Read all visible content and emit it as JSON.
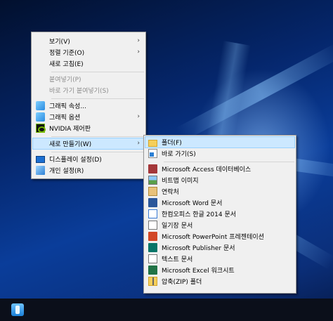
{
  "context_menu": {
    "items": [
      {
        "label": "보기(V)",
        "submenu": true,
        "disabled": false,
        "icon": ""
      },
      {
        "label": "정렬 기준(O)",
        "submenu": true,
        "disabled": false,
        "icon": ""
      },
      {
        "label": "새로 고침(E)",
        "submenu": false,
        "disabled": false,
        "icon": ""
      },
      {
        "label": "붙여넣기(P)",
        "submenu": false,
        "disabled": true,
        "icon": ""
      },
      {
        "label": "바로 가기 붙여넣기(S)",
        "submenu": false,
        "disabled": true,
        "icon": ""
      },
      {
        "label": "그래픽 속성...",
        "submenu": false,
        "disabled": false,
        "icon": "intel-graphics-icon"
      },
      {
        "label": "그래픽 옵션",
        "submenu": true,
        "disabled": false,
        "icon": "intel-graphics-icon"
      },
      {
        "label": "NVIDIA 제어판",
        "submenu": false,
        "disabled": false,
        "icon": "nvidia-icon"
      },
      {
        "label": "새로 만들기(W)",
        "submenu": true,
        "disabled": false,
        "icon": "",
        "highlighted": true
      },
      {
        "label": "디스플레이 설정(D)",
        "submenu": false,
        "disabled": false,
        "icon": "display-icon"
      },
      {
        "label": "개인 설정(R)",
        "submenu": false,
        "disabled": false,
        "icon": "personalize-icon"
      }
    ],
    "submenu_arrow": "›"
  },
  "new_submenu": {
    "items": [
      {
        "label": "폴더(F)",
        "icon": "folder-icon",
        "highlighted": true
      },
      {
        "label": "바로 가기(S)",
        "icon": "shortcut-icon"
      },
      {
        "label": "Microsoft Access 데이터베이스",
        "icon": "access-icon"
      },
      {
        "label": "비트맵 이미지",
        "icon": "bitmap-icon"
      },
      {
        "label": "연락처",
        "icon": "contact-icon"
      },
      {
        "label": "Microsoft Word 문서",
        "icon": "word-icon"
      },
      {
        "label": "한컴오피스 한글 2014 문서",
        "icon": "hwp-icon"
      },
      {
        "label": "일기장 문서",
        "icon": "journal-icon"
      },
      {
        "label": "Microsoft PowerPoint 프레젠테이션",
        "icon": "powerpoint-icon"
      },
      {
        "label": "Microsoft Publisher 문서",
        "icon": "publisher-icon"
      },
      {
        "label": "텍스트 문서",
        "icon": "text-document-icon"
      },
      {
        "label": "Microsoft Excel 워크시트",
        "icon": "excel-icon"
      },
      {
        "label": "압축(ZIP) 폴더",
        "icon": "zip-folder-icon"
      }
    ]
  },
  "colors": {
    "highlight": "#cce8ff",
    "menu_bg": "#f0f0f0",
    "disabled_text": "#8d8d8d"
  }
}
